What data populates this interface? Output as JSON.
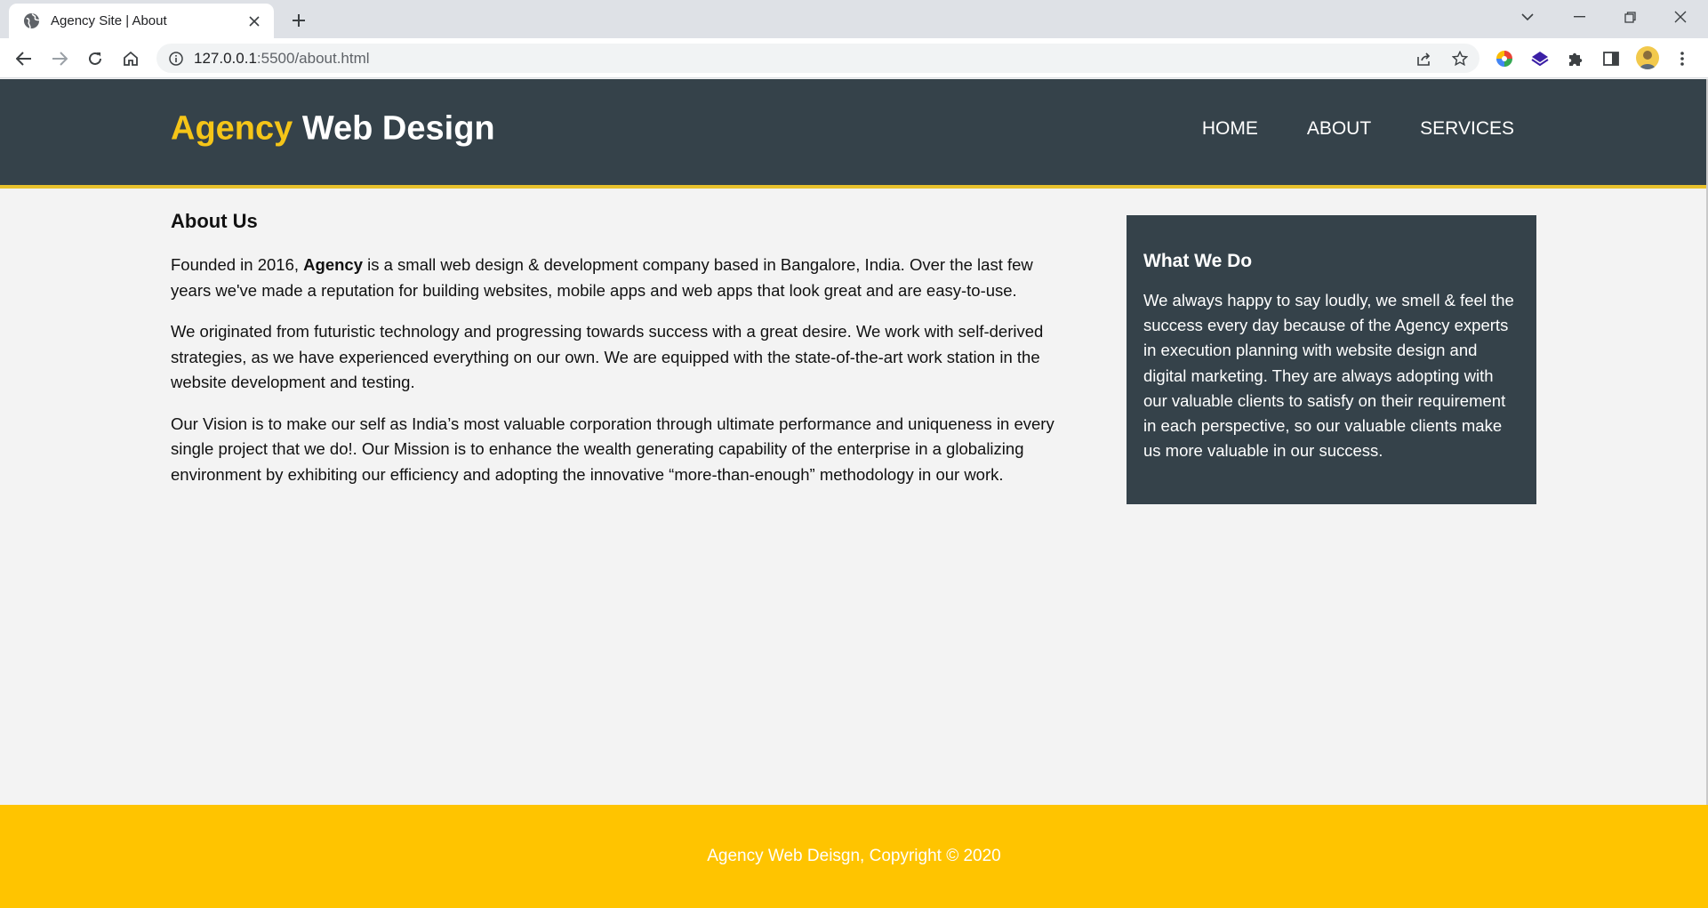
{
  "browser": {
    "tab_title": "Agency Site | About",
    "url_host": "127.0.0.1",
    "url_path": ":5500/about.html"
  },
  "site": {
    "brand_highlight": "Agency",
    "brand_rest": "Web Design",
    "nav": [
      "HOME",
      "ABOUT",
      "SERVICES"
    ]
  },
  "about": {
    "heading": "About Us",
    "p1_before": "Founded in 2016, ",
    "p1_bold": "Agency",
    "p1_after": " is a small web design & development company based in Bangalore, India. Over the last few years we've made a reputation for building websites, mobile apps and web apps that look great and are easy-to-use.",
    "p2": "We originated from futuristic technology and progressing towards success with a great desire. We work with self-derived strategies, as we have experienced everything on our own. We are equipped with the state-of-the-art work station in the website development and testing.",
    "p3": "Our Vision is to make our self as India’s most valuable corporation through ultimate performance and uniqueness in every single project that we do!. Our Mission is to enhance the wealth generating capability of the enterprise in a globalizing environment by exhibiting our efficiency and adopting the innovative “more-than-enough” methodology in our work."
  },
  "sidebar": {
    "heading": "What We Do",
    "text": "We always happy to say loudly, we smell & feel the success every day because of the Agency experts in execution planning with website design and digital marketing. They are always adopting with our valuable clients to satisfy on their requirement in each perspective, so our valuable clients make us more valuable in our success."
  },
  "footer": {
    "text": "Agency Web Deisgn, Copyright © 2020"
  },
  "colors": {
    "header_bg": "#35424a",
    "accent": "#f5c518",
    "footer_bg": "#ffc400",
    "page_bg": "#f3f3f3"
  },
  "icons": [
    "globe-favicon-icon",
    "close-icon",
    "plus-icon",
    "chevron-down-icon",
    "minimize-icon",
    "restore-icon",
    "window-close-icon",
    "back-icon",
    "forward-icon",
    "reload-icon",
    "home-icon",
    "info-icon",
    "share-icon",
    "star-icon",
    "color-wheel-extension-icon",
    "layers-extension-icon",
    "puzzle-icon",
    "side-panel-icon",
    "avatar",
    "kebab-menu-icon"
  ]
}
